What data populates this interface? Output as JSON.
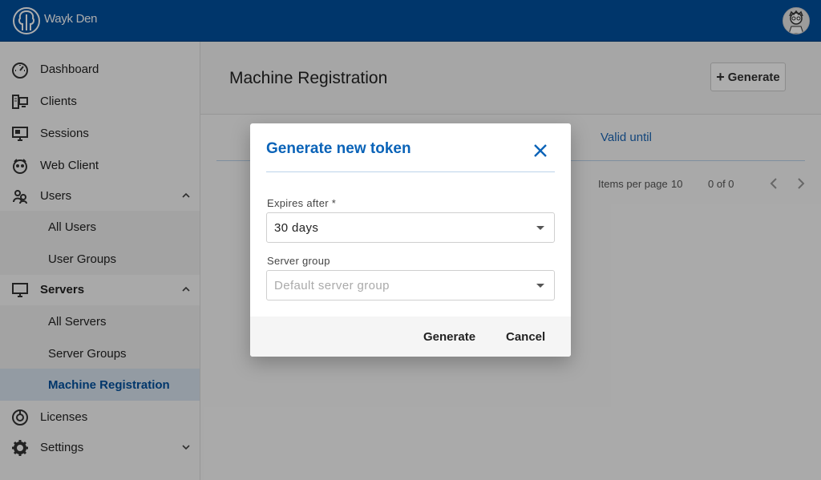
{
  "app": {
    "brand": "Wayk Den"
  },
  "sidebar": {
    "items": [
      {
        "label": "Dashboard",
        "icon": "dashboard-icon"
      },
      {
        "label": "Clients",
        "icon": "clients-icon"
      },
      {
        "label": "Sessions",
        "icon": "sessions-icon"
      },
      {
        "label": "Web Client",
        "icon": "web-client-icon"
      },
      {
        "label": "Users",
        "icon": "users-icon",
        "expanded": true
      },
      {
        "label": "All Users"
      },
      {
        "label": "User Groups"
      },
      {
        "label": "Servers",
        "icon": "servers-icon",
        "expanded": true
      },
      {
        "label": "All Servers"
      },
      {
        "label": "Server Groups"
      },
      {
        "label": "Machine Registration",
        "active": true
      },
      {
        "label": "Licenses",
        "icon": "licenses-icon"
      },
      {
        "label": "Settings",
        "icon": "settings-icon",
        "expanded": false
      }
    ]
  },
  "main": {
    "title": "Machine Registration",
    "generate_label": "Generate",
    "column_valid_until": "Valid until",
    "items_per_page_label": "Items per page",
    "items_per_page_value": "10",
    "range": "0 of 0"
  },
  "dialog": {
    "title": "Generate new token",
    "expires_label": "Expires after *",
    "expires_value": "30 days",
    "server_group_label": "Server group",
    "server_group_placeholder": "Default server group",
    "generate_label": "Generate",
    "cancel_label": "Cancel"
  },
  "colors": {
    "header": "#00509e",
    "accent": "#0a63b8",
    "active_bg": "#d9e5f1"
  }
}
